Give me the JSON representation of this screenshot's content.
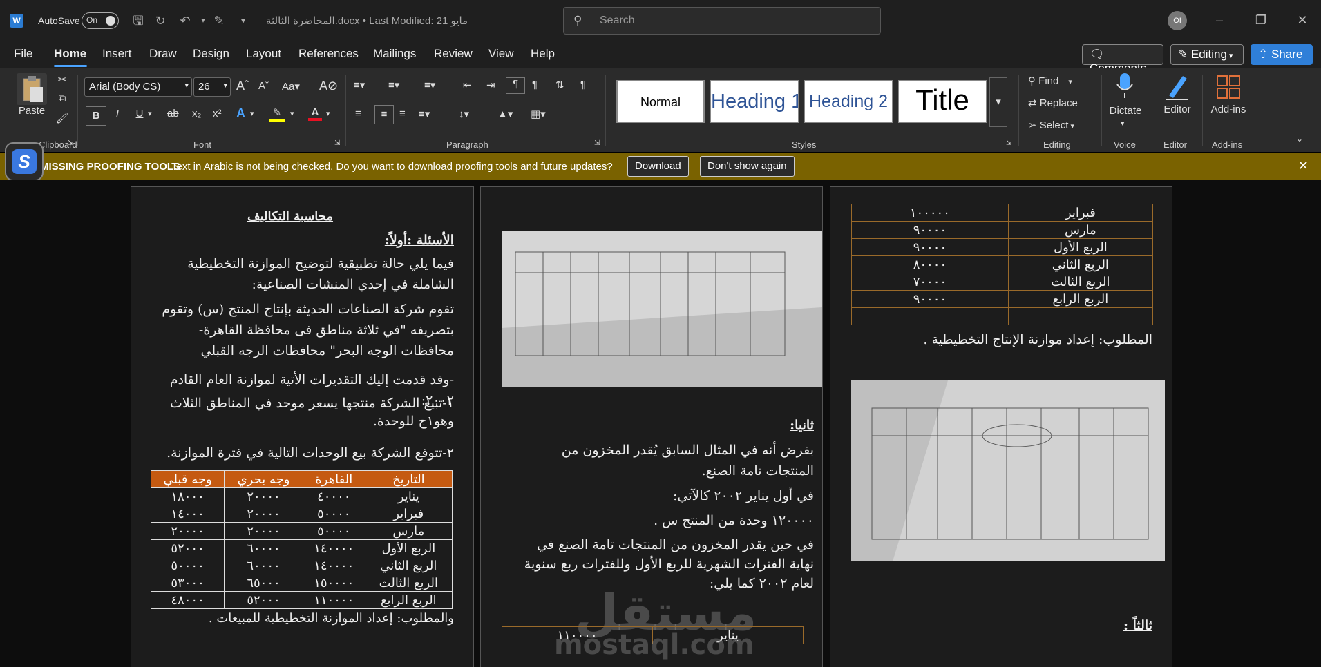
{
  "titlebar": {
    "autosave_label": "AutoSave",
    "toggle_state": "On",
    "doc_title": "المحاضرة الثالثة.docx • Last Modified: 21 مايو",
    "search_placeholder": "Search",
    "avatar_initials": "OI"
  },
  "menu": {
    "tabs": [
      "File",
      "Home",
      "Insert",
      "Draw",
      "Design",
      "Layout",
      "References",
      "Mailings",
      "Review",
      "View",
      "Help"
    ],
    "active": "Home",
    "comments": "Comments",
    "editing": "Editing",
    "share": "Share"
  },
  "ribbon": {
    "clipboard": {
      "paste": "Paste",
      "label": "Clipboard"
    },
    "font": {
      "name": "Arial (Body CS)",
      "size": "26",
      "label": "Font"
    },
    "paragraph": {
      "label": "Paragraph"
    },
    "styles": {
      "items": [
        "Normal",
        "Heading 1",
        "Heading 2",
        "Title"
      ],
      "label": "Styles"
    },
    "editing": {
      "find": "Find",
      "replace": "Replace",
      "select": "Select",
      "label": "Editing"
    },
    "voice": {
      "dictate": "Dictate",
      "label": "Voice"
    },
    "editor": {
      "name": "Editor",
      "label": "Editor"
    },
    "addins": {
      "name": "Add-ins",
      "label": "Add-ins"
    }
  },
  "notice": {
    "title": "MISSING PROOFING TOOLS",
    "text": "Text in Arabic is not being checked. Do you want to download proofing tools and future updates?",
    "download": "Download",
    "dont_show": "Don't show again"
  },
  "page1": {
    "title": "محاسبة التكاليف",
    "q1": "الأسئلة :أولاً:",
    "p1": "فيما يلي حالة تطبيقية لتوضيح الموازنة التخطيطية الشاملة في إحدي المنشات الصناعية:",
    "p2": "تقوم شركة الصناعات الحديثة بإنتاج المنتج (س) وتقوم بتصريفه \"في ثلاثة مناطق فى محافظة القاهرة- محافظات الوجه البحر\" محافظات الرجه القبلي",
    "p3": "-وقد قدمت إليك التقديرات الأتية لموازنة العام القادم ٢٠٠٢:",
    "p4": "١-تبيع الشركة منتجها يسعر موحد في المناطق الثلاث وهو١ج للوحدة.",
    "p5": "٢-تتوقع الشركة بيع الوحدات التالية في فترة الموازنة.",
    "table_headers": [
      "التاريخ",
      "القاهرة",
      "وجه بحري",
      "وجه قبلي"
    ],
    "table_rows": [
      [
        "يناير",
        "٤٠٠٠٠",
        "٢٠٠٠٠",
        "١٨٠٠٠"
      ],
      [
        "فبراير",
        "٥٠٠٠٠",
        "٢٠٠٠٠",
        "١٤٠٠٠"
      ],
      [
        "مارس",
        "٥٠٠٠٠",
        "٢٠٠٠٠",
        "٢٠٠٠٠"
      ],
      [
        "الربع الأول",
        "١٤٠٠٠٠",
        "٦٠٠٠٠",
        "٥٢٠٠٠"
      ],
      [
        "الربع الثاني",
        "١٤٠٠٠٠",
        "٦٠٠٠٠",
        "٥٠٠٠٠"
      ],
      [
        "الربع الثالث",
        "١٥٠٠٠٠",
        "٦٥٠٠٠",
        "٥٣٠٠٠"
      ],
      [
        "الربع الرابع",
        "١١٠٠٠٠",
        "٥٢٠٠٠",
        "٤٨٠٠٠"
      ]
    ],
    "required": "والمطلوب: إعداد الموازنة التخطيطية للمبيعات ."
  },
  "page2": {
    "q2": "ثانيا:",
    "p1": "بفرض أنه في المثال السابق يُقدر المخزون من المنتجات تامة الصنع.",
    "p2": "في أول يناير ٢٠٠٢ كالآتي:",
    "p3": "١٢٠٠٠٠ وحدة من المنتج س .",
    "p4": "في حين يقدر المخزون من المنتجات تامة الصنع في نهاية الفترات الشهرية للربع الأول وللفترات ربع سنوية لعام ٢٠٠٢ كما يلي:",
    "table_row": [
      "يناير",
      "١١٠٠٠٠"
    ],
    "watermark_ar": "مستقل",
    "watermark_en": "mostaql.com"
  },
  "page3": {
    "table_rows": [
      [
        "فبراير",
        "١٠٠٠٠٠"
      ],
      [
        "مارس",
        "٩٠٠٠٠"
      ],
      [
        "الربع الأول",
        "٩٠٠٠٠"
      ],
      [
        "الربع الثاني",
        "٨٠٠٠٠"
      ],
      [
        "الربع الثالث",
        "٧٠٠٠٠"
      ],
      [
        "الربع الرابع",
        "٩٠٠٠٠"
      ],
      [
        "",
        ""
      ]
    ],
    "required": "المطلوب: إعداد موازنة الإنتاج التخطيطية .",
    "q3": "ثالثاً :"
  },
  "colors": {
    "accent": "#2f7fd8",
    "notice_bg": "#7a6200",
    "table_header": "#c55a11"
  }
}
